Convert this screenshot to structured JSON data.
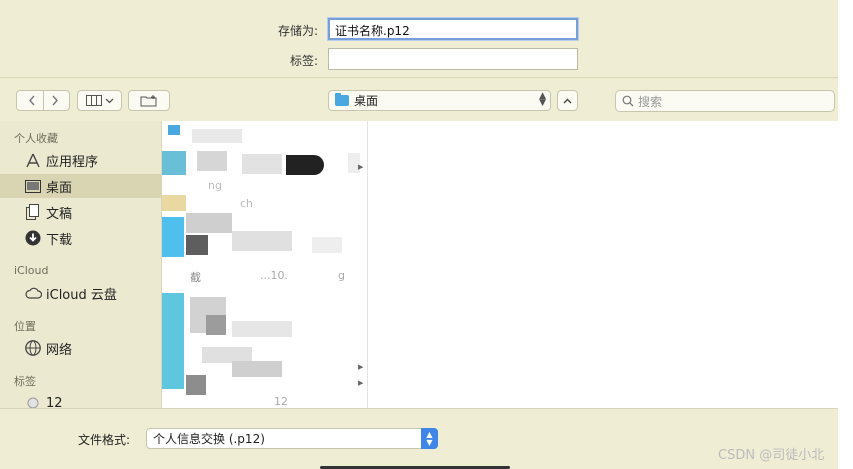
{
  "save_as": {
    "label": "存储为:",
    "value": "证书名称.p12"
  },
  "tags": {
    "label": "标签:",
    "value": ""
  },
  "toolbar": {
    "back_icon": "chevron-left-icon",
    "forward_icon": "chevron-right-icon",
    "view_icon": "columns-view-icon",
    "new_folder_icon": "new-folder-icon",
    "location": "桌面",
    "expand_icon": "chevron-up-icon"
  },
  "search": {
    "placeholder": "搜索"
  },
  "sidebar": {
    "favorites_title": "个人收藏",
    "favorites": [
      {
        "label": "应用程序",
        "icon": "applications-icon"
      },
      {
        "label": "桌面",
        "icon": "desktop-icon",
        "selected": true
      },
      {
        "label": "文稿",
        "icon": "documents-icon"
      },
      {
        "label": "下载",
        "icon": "download-icon"
      }
    ],
    "icloud_title": "iCloud",
    "icloud_items": [
      {
        "label": "iCloud 云盘",
        "icon": "cloud-icon"
      }
    ],
    "locations_title": "位置",
    "locations": [
      {
        "label": "网络",
        "icon": "network-icon"
      }
    ],
    "tags_title": "标签",
    "tags": [
      {
        "label": "12",
        "icon": "tag-circle-icon"
      }
    ]
  },
  "files_visible_fragments": [
    "ng",
    "ch",
    "截",
    "...10.",
    "g",
    "12"
  ],
  "bottom": {
    "format_label": "文件格式:",
    "format_value": "个人信息交换 (.p12)"
  },
  "watermark": "CSDN @司徒小北",
  "colors": {
    "accent": "#3f86e8",
    "folder": "#4aa8e0",
    "sidebar_selected": "#d9d5b3"
  }
}
